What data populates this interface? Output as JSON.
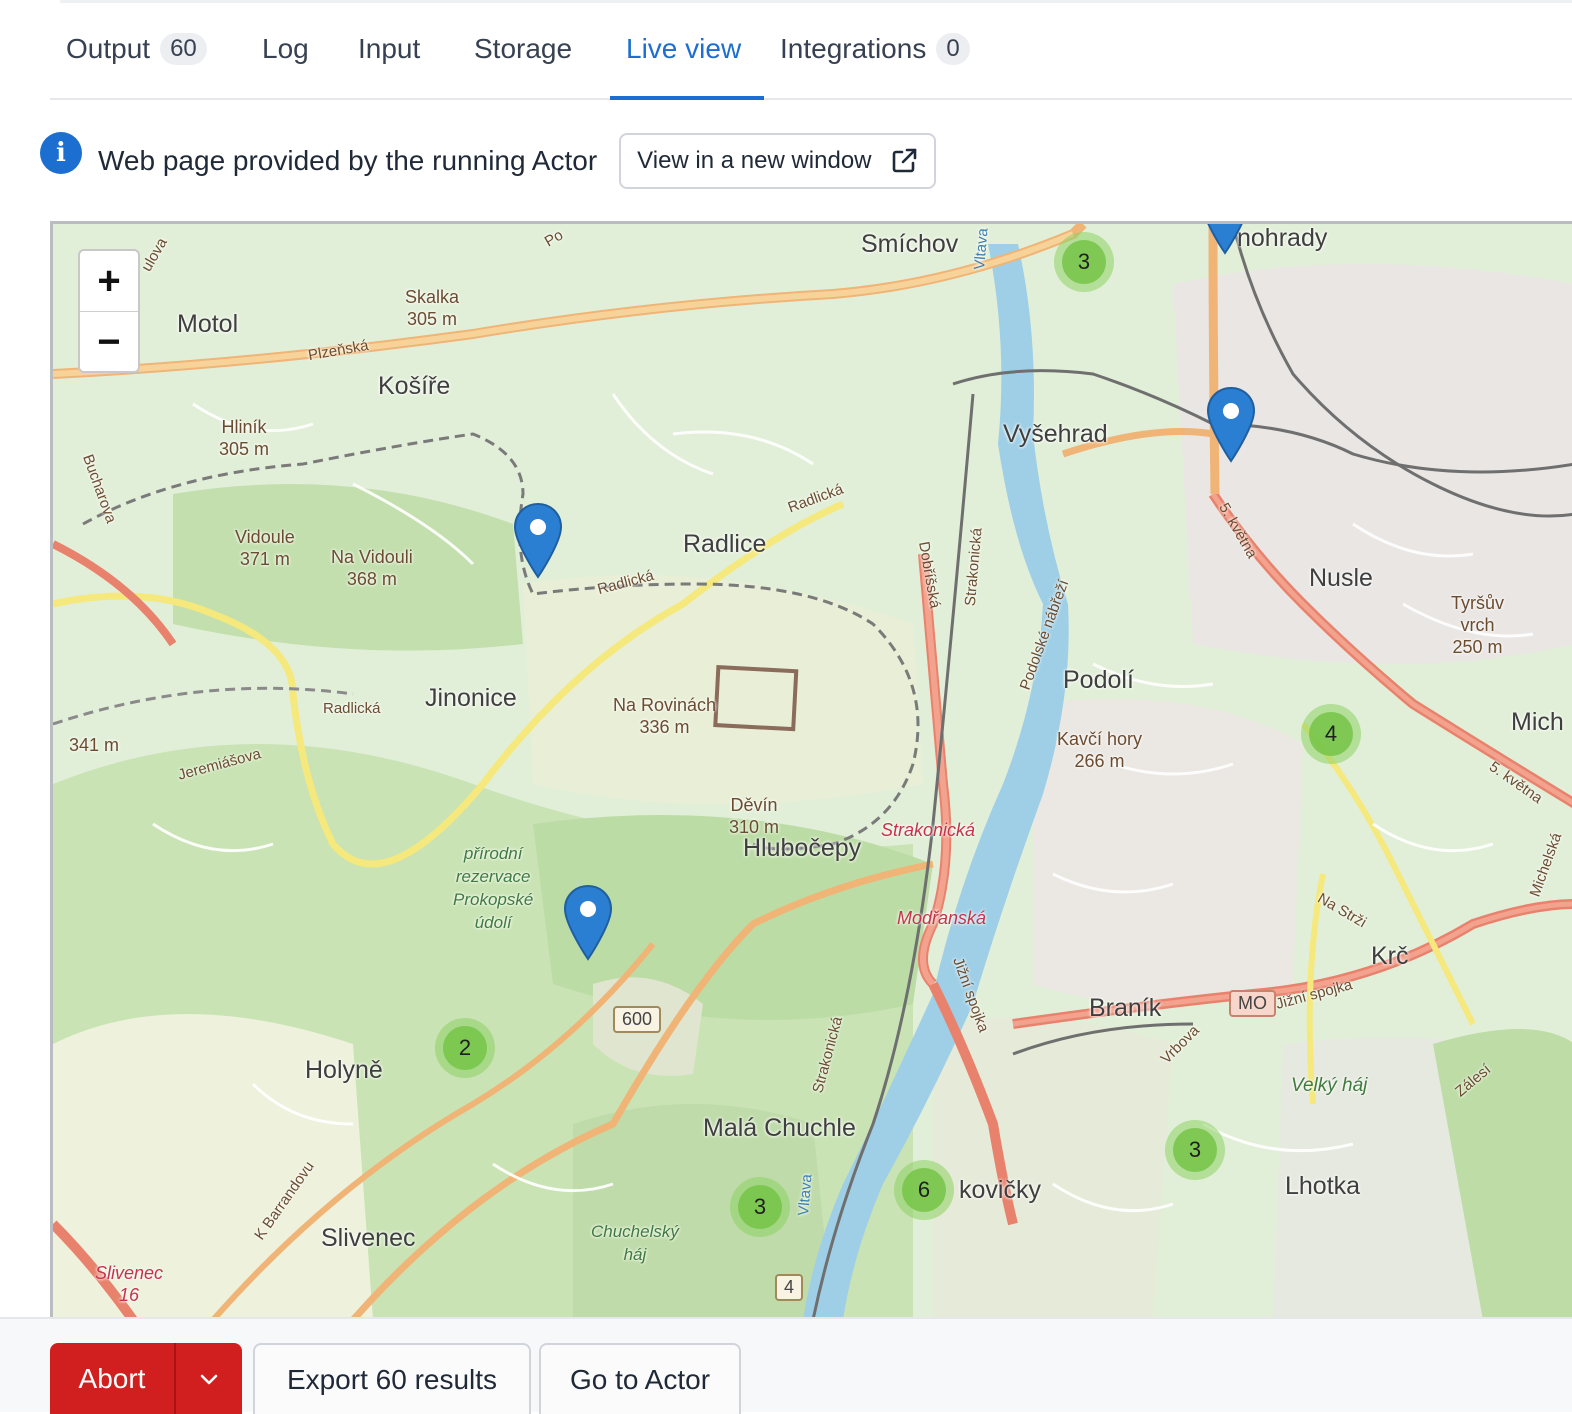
{
  "tabs": [
    {
      "label": "Output",
      "badge": "60"
    },
    {
      "label": "Log"
    },
    {
      "label": "Input"
    },
    {
      "label": "Storage"
    },
    {
      "label": "Live view",
      "active": true
    },
    {
      "label": "Integrations",
      "badge": "0"
    }
  ],
  "notice": {
    "icon": "info-icon",
    "text": "Web page provided by the running Actor",
    "button_label": "View in a new window",
    "button_icon": "external-link-icon"
  },
  "map": {
    "zoom_in": "+",
    "zoom_out": "−",
    "places": {
      "smichov": "Smíchov",
      "vinohrady": "nohrady",
      "motol": "Motol",
      "skalka": "Skalka",
      "skalka_elev": "305 m",
      "kosire": "Košíře",
      "hlinik": "Hliník",
      "hlinik_elev": "305 m",
      "vysehrad": "Vyšehrad",
      "radlice": "Radlice",
      "vidoule": "Vidoule",
      "vidoule_elev": "371 m",
      "na_vidouli": "Na Vidouli",
      "na_vidouli_elev": "368 m",
      "nusle": "Nusle",
      "tyrsuv": "Tyršův",
      "tyrsuv_2": "vrch",
      "tyrsuv_elev": "250 m",
      "jinonice": "Jinonice",
      "na_rovinach": "Na Rovinách",
      "na_rovinach_elev": "336 m",
      "podoli": "Podolí",
      "kavci_hory": "Kavčí hory",
      "kavci_elev": "266 m",
      "mich": "Mich",
      "elev_341": "341 m",
      "devin": "Děvín",
      "devin_elev": "310 m",
      "hlubocepy": "Hlubočepy",
      "prirodni_1": "přírodní",
      "prirodni_2": "rezervace",
      "prirodni_3": "Prokopské",
      "prirodni_4": "údolí",
      "strakonicka_red": "Strakonická",
      "modranska": "Modřanská",
      "krc": "Krč",
      "branik": "Braník",
      "holyne": "Holyně",
      "velky_haj": "Velký háj",
      "mala_chuchle": "Malá Chuchle",
      "lhotka": "Lhotka",
      "kovicky": "kovičky",
      "slivenec": "Slivenec",
      "chuchelsky_1": "Chuchelský",
      "chuchelsky_2": "háj",
      "slivenec_red": "Slivenec",
      "slivenec_red_num": "16"
    },
    "streets": {
      "plzenska": "Plzeňská",
      "radlicka_1": "Radlická",
      "radlicka_2": "Radlická",
      "radlicka_3": "Radlická",
      "jeremiasova": "Jeremiášova",
      "bucharova": "Bucharova",
      "dobrisska": "Dobříšská",
      "strakonicka_1": "Strakonická",
      "strakonicka_2": "Strakonická",
      "podolske": "Podolské nábřeží",
      "kvetna_1": "5. května",
      "kvetna_2": "5. května",
      "na_strzi": "Na Strži",
      "jizni_spojka_1": "Jižní spojka",
      "jizni_spojka_2": "Jižní spojka",
      "vrbova": "Vrbova",
      "zalesi": "Zálesí",
      "k_barrandovu": "K Barrandovu",
      "michelska": "Michelská",
      "vltava_1": "Vltava",
      "vltava_2": "Vltava",
      "ulova": "ulova",
      "po": "Po"
    },
    "road_signs": [
      "600",
      "MO",
      "4"
    ],
    "clusters": [
      "3",
      "4",
      "2",
      "3",
      "6",
      "3"
    ]
  },
  "actions": {
    "abort_label": "Abort",
    "export_label": "Export 60 results",
    "goto_label": "Go to Actor"
  }
}
